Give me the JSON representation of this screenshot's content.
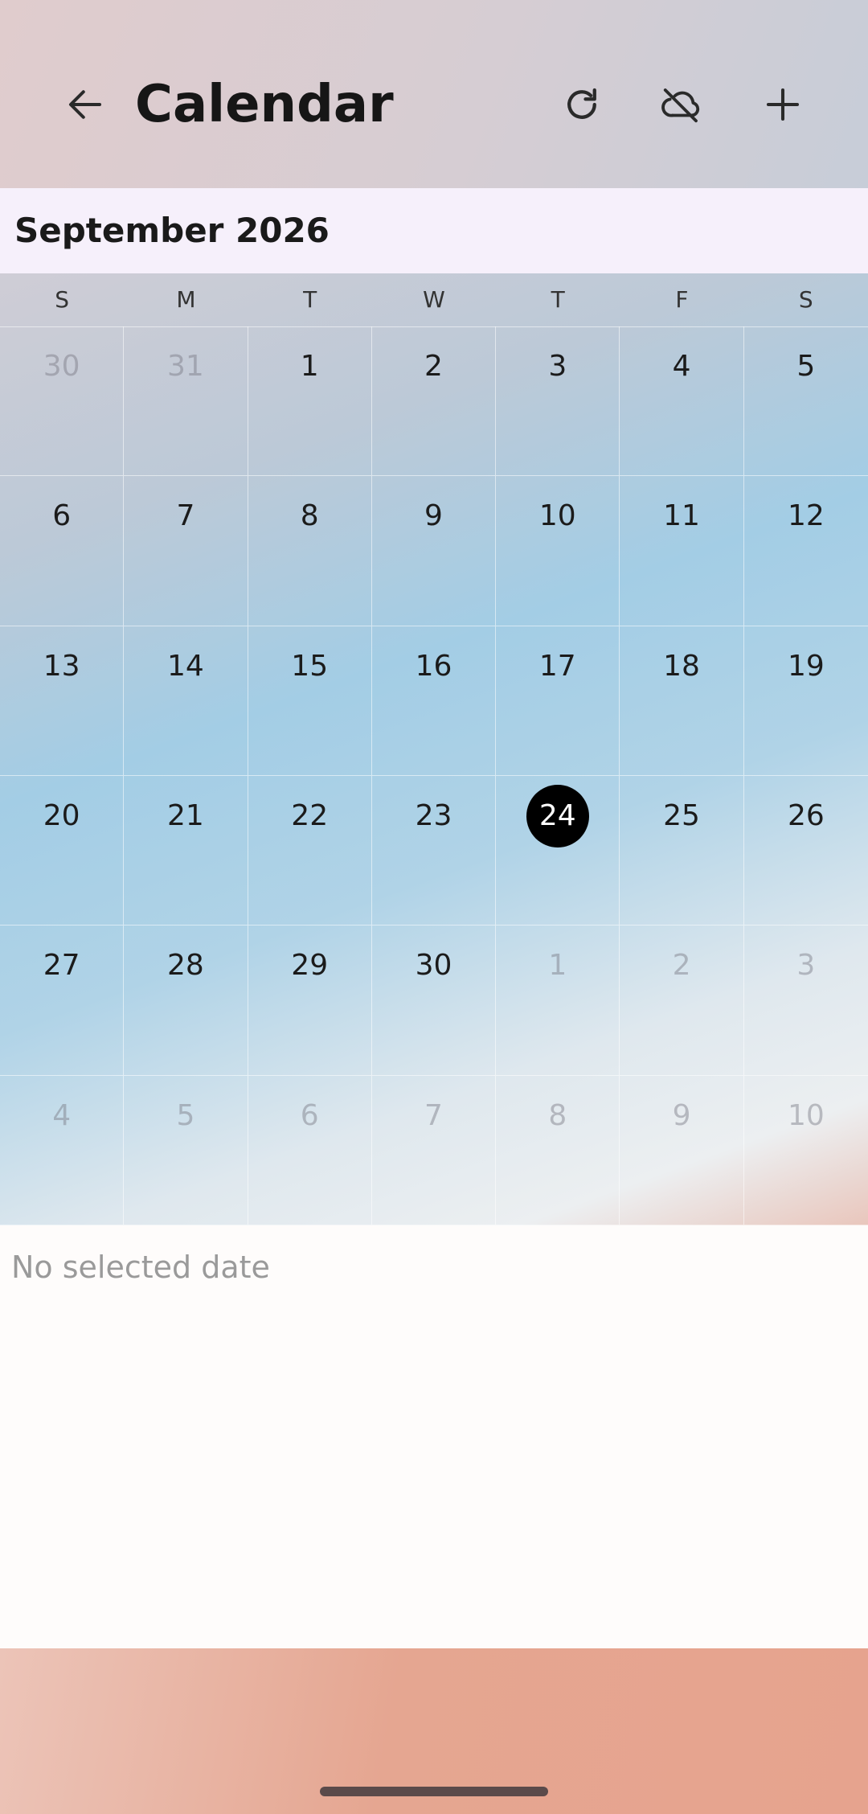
{
  "appbar": {
    "title": "Calendar",
    "icons": {
      "back": "arrow-left-icon",
      "refresh": "refresh-icon",
      "cloud_off": "cloud-off-icon",
      "add": "plus-icon"
    }
  },
  "month_header": "September 2026",
  "weekdays": [
    "S",
    "M",
    "T",
    "W",
    "T",
    "F",
    "S"
  ],
  "days": [
    {
      "n": "30",
      "muted": true
    },
    {
      "n": "31",
      "muted": true
    },
    {
      "n": "1"
    },
    {
      "n": "2"
    },
    {
      "n": "3"
    },
    {
      "n": "4"
    },
    {
      "n": "5"
    },
    {
      "n": "6"
    },
    {
      "n": "7"
    },
    {
      "n": "8"
    },
    {
      "n": "9"
    },
    {
      "n": "10"
    },
    {
      "n": "11"
    },
    {
      "n": "12"
    },
    {
      "n": "13"
    },
    {
      "n": "14"
    },
    {
      "n": "15"
    },
    {
      "n": "16"
    },
    {
      "n": "17"
    },
    {
      "n": "18"
    },
    {
      "n": "19"
    },
    {
      "n": "20"
    },
    {
      "n": "21"
    },
    {
      "n": "22"
    },
    {
      "n": "23"
    },
    {
      "n": "24",
      "selected": true
    },
    {
      "n": "25"
    },
    {
      "n": "26"
    },
    {
      "n": "27"
    },
    {
      "n": "28"
    },
    {
      "n": "29"
    },
    {
      "n": "30"
    },
    {
      "n": "1",
      "muted": true
    },
    {
      "n": "2",
      "muted": true
    },
    {
      "n": "3",
      "muted": true
    },
    {
      "n": "4",
      "muted": true
    },
    {
      "n": "5",
      "muted": true
    },
    {
      "n": "6",
      "muted": true
    },
    {
      "n": "7",
      "muted": true
    },
    {
      "n": "8",
      "muted": true
    },
    {
      "n": "9",
      "muted": true
    },
    {
      "n": "10",
      "muted": true
    }
  ],
  "detail": {
    "empty_text": "No selected date"
  },
  "colors": {
    "selected_day_bg": "#000000",
    "selected_day_text": "#ffffff",
    "muted_text": "#b6b6bd"
  }
}
